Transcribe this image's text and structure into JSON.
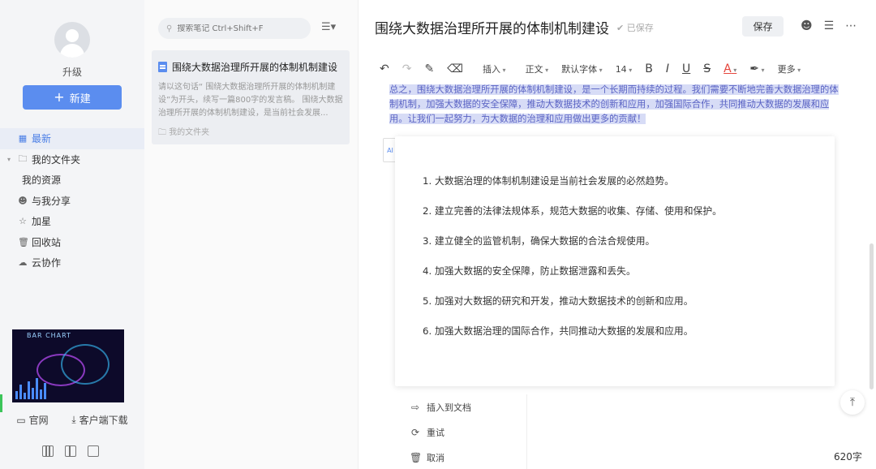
{
  "sidebar": {
    "upgrade_label": "升级",
    "new_button_label": "新建",
    "nav": [
      {
        "label": "最新",
        "icon": "grid-icon",
        "active": true
      },
      {
        "label": "我的文件夹",
        "icon": "folder-icon"
      },
      {
        "label": "我的资源",
        "icon": ""
      },
      {
        "label": "与我分享",
        "icon": "user-icon"
      },
      {
        "label": "加星",
        "icon": "star-icon"
      },
      {
        "label": "回收站",
        "icon": "trash-icon"
      },
      {
        "label": "云协作",
        "icon": "cloud-icon"
      }
    ],
    "thumbnail_text": "BAR CHART",
    "footer": {
      "website_label": "官网",
      "download_label": "客户端下载"
    }
  },
  "notelist": {
    "search_placeholder": "搜索笔记 Ctrl+Shift+F",
    "note": {
      "title": "围绕大数据治理所开展的体制机制建设",
      "snippet": "请以这句话“ 围绕大数据治理所开展的体制机制建设”为开头，续写一篇800字的发言稿。 围绕大数据治理所开展的体制机制建设，是当前社会发展...",
      "folder": "我的文件夹"
    }
  },
  "editor": {
    "title": "围绕大数据治理所开展的体制机制建设",
    "saved_status": "已保存",
    "save_button": "保存",
    "toolbar": {
      "insert": "插入",
      "paragraph": "正文",
      "font": "默认字体",
      "size": "14",
      "bold": "B",
      "italic": "I",
      "underline": "U",
      "strike": "S",
      "font_color": "A",
      "more": "更多"
    },
    "highlighted_text": "总之，围绕大数据治理所开展的体制机制建设，是一个长期而持续的过程。我们需要不断地完善大数据治理的体制机制，加强大数据的安全保障，推动大数据技术的创新和应用，加强国际合作，共同推动大数据的发展和应用。让我们一起努力，为大数据的治理和应用做出更多的贡献！",
    "ai_items": [
      "1. 大数据治理的体制机制建设是当前社会发展的必然趋势。",
      "2. 建立完善的法律法规体系，规范大数据的收集、存储、使用和保护。",
      "3. 建立健全的监管机制，确保大数据的合法合规使用。",
      "4. 加强大数据的安全保障，防止数据泄露和丢失。",
      "5. 加强对大数据的研究和开发，推动大数据技术的创新和应用。",
      "6. 加强大数据治理的国际合作，共同推动大数据的发展和应用。"
    ],
    "actions": {
      "insert": "插入到文档",
      "retry": "重试",
      "cancel": "取消"
    },
    "word_count": "620字"
  },
  "colors": {
    "accent": "#5b8def",
    "highlight": "#d7dcf6",
    "highlight_text": "#5a63c4"
  }
}
